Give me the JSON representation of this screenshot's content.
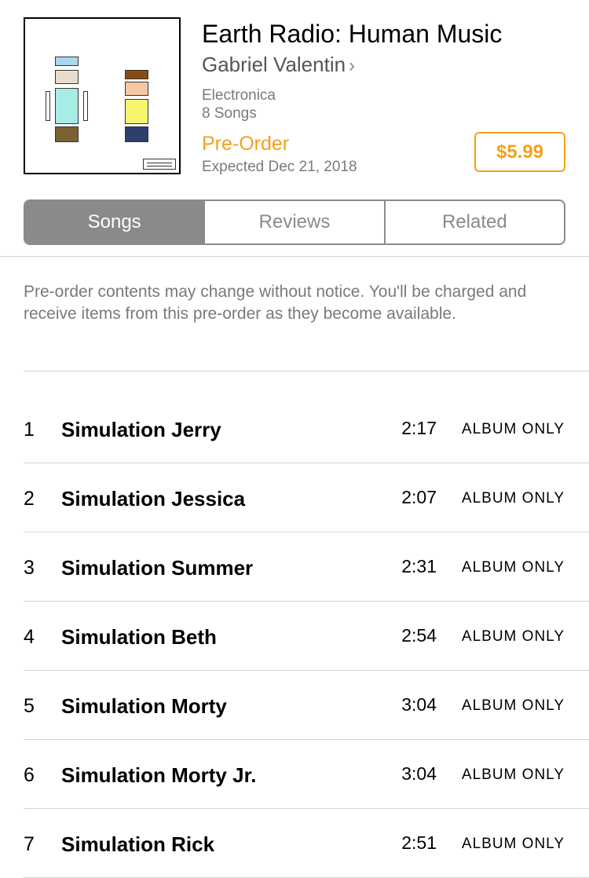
{
  "album": {
    "title": "Earth Radio: Human Music",
    "artist": "Gabriel Valentin",
    "artist_chevron": "›",
    "genre": "Electronica",
    "song_count": "8 Songs",
    "status": "Pre-Order",
    "expected": "Expected Dec 21, 2018",
    "price": "$5.99",
    "artwork_colors": {
      "sky": "#a8d8f0",
      "beige": "#e8dccb",
      "cyan": "#a8ece6",
      "olive": "#7a6234",
      "brown": "#8a4b12",
      "peach": "#f5c8a4",
      "yellow": "#f6f56c",
      "navy": "#2c3f6e"
    }
  },
  "tabs": [
    {
      "label": "Songs",
      "active": true
    },
    {
      "label": "Reviews",
      "active": false
    },
    {
      "label": "Related",
      "active": false
    }
  ],
  "notice": "Pre-order contents may change without notice. You'll be charged and receive items from this pre-order as they become available.",
  "tracks": [
    {
      "number": "1",
      "title": "Simulation Jerry",
      "duration": "2:17",
      "availability": "ALBUM ONLY"
    },
    {
      "number": "2",
      "title": "Simulation Jessica",
      "duration": "2:07",
      "availability": "ALBUM ONLY"
    },
    {
      "number": "3",
      "title": "Simulation Summer",
      "duration": "2:31",
      "availability": "ALBUM ONLY"
    },
    {
      "number": "4",
      "title": "Simulation Beth",
      "duration": "2:54",
      "availability": "ALBUM ONLY"
    },
    {
      "number": "5",
      "title": "Simulation Morty",
      "duration": "3:04",
      "availability": "ALBUM ONLY"
    },
    {
      "number": "6",
      "title": "Simulation Morty Jr.",
      "duration": "3:04",
      "availability": "ALBUM ONLY"
    },
    {
      "number": "7",
      "title": "Simulation Rick",
      "duration": "2:51",
      "availability": "ALBUM ONLY"
    }
  ],
  "colors": {
    "accent": "#f0a21a",
    "segment": "#8a8a8a",
    "secondary_text": "#7a7a7a"
  }
}
